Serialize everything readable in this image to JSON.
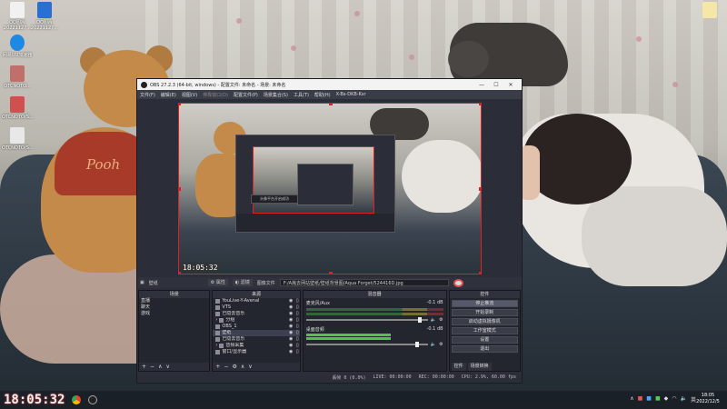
{
  "desktop": {
    "icons": [
      {
        "label": "QQ图片20221127..."
      },
      {
        "label": "QQ图片20221127..."
      },
      {
        "label": "网易UU加速器"
      },
      {
        "label": "OTCNOTO..."
      },
      {
        "label": "OTCNOTO(S..."
      },
      {
        "label": "OTCNOTO(S..."
      }
    ],
    "wallpaper_text": "Pooh"
  },
  "obs": {
    "title": "OBS 27.2.3 (64-bit, windows) - 配置文件: 未命名 - 场景: 未命名",
    "menu": [
      "文件(F)",
      "编辑(E)",
      "视图(V)",
      "停靠窗口(D)",
      "配置文件(P)",
      "场景集合(S)",
      "工具(T)",
      "帮助(H)",
      "X-Bs-DKB-Ksr"
    ],
    "preview": {
      "clock": "18:05:32",
      "toast": "头像平台开启成功"
    },
    "source_bar": {
      "selected": "壁纸",
      "properties": "属性",
      "filters": "滤镜",
      "image_file": "图像文件",
      "path": "F:/A胤去网站壁纸/壁纸背景图/Aqua Forget/524416D.jpg"
    },
    "scenes": {
      "header": "场景",
      "items": [
        "直播",
        "聊天",
        "游戏"
      ]
    },
    "sources": {
      "header": "来源",
      "items": [
        {
          "label": "YouLive-Y-Avenal",
          "selected": false
        },
        {
          "label": "VTS",
          "selected": false
        },
        {
          "label": "已隐去音乐",
          "selected": false
        },
        {
          "label": "分组",
          "selected": false
        },
        {
          "label": "OBS_1",
          "selected": false
        },
        {
          "label": "壁纸",
          "selected": true
        },
        {
          "label": "已隐去音乐",
          "selected": false
        },
        {
          "label": "音频采集",
          "selected": false
        },
        {
          "label": "窗口/显示器",
          "selected": false
        }
      ]
    },
    "mixer": {
      "header": "混音器",
      "channels": [
        {
          "name": "麦克风/Aux",
          "db": "-0.1 dB",
          "level": 0.0,
          "volume": 0.95
        },
        {
          "name": "桌面音频",
          "db": "-0.1 dB",
          "level": 0.62,
          "volume": 0.93
        }
      ]
    },
    "controls": {
      "header": "控件",
      "buttons": [
        {
          "label": "停止推流",
          "active": true
        },
        {
          "label": "开始录制",
          "active": false
        },
        {
          "label": "启动虚拟摄像机",
          "active": false
        },
        {
          "label": "工作室模式",
          "active": false
        },
        {
          "label": "设置",
          "active": false
        },
        {
          "label": "退出",
          "active": false
        }
      ],
      "tabs": [
        "控件",
        "场景转换"
      ]
    },
    "status": {
      "drop": "丢帧 0 (0.0%)",
      "live": "LIVE: 00:00:00",
      "rec": "REC: 00:00:00",
      "cpu": "CPU: 2.9%, 60.00 fps"
    }
  },
  "taskbar": {
    "clock": "18:05:32",
    "time": "18:05",
    "date": "2022/12/5",
    "lang": "英"
  },
  "colors": {
    "selection": "#e02020",
    "obs_bg": "#2b2e38",
    "meter_green": "#52c24a"
  }
}
